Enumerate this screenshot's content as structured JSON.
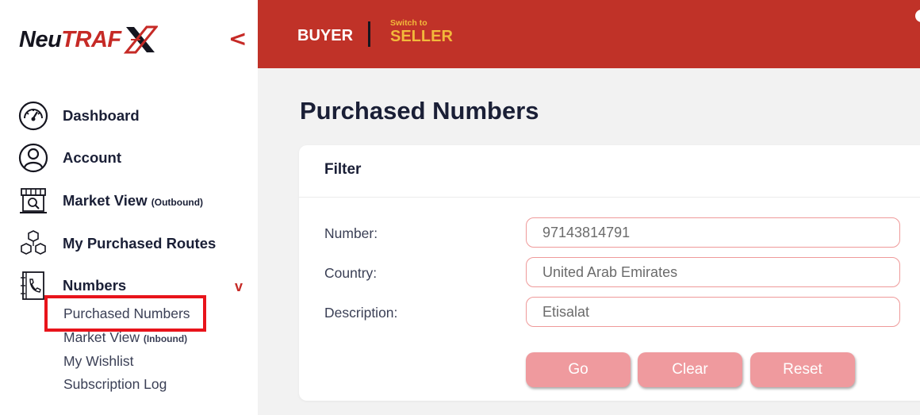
{
  "brand": {
    "part1": "Neu",
    "part2": "TRAF",
    "mark": "X"
  },
  "sidebar": {
    "collapse_glyph": "<",
    "items": [
      {
        "label": "Dashboard",
        "icon": "dashboard-gauge-icon"
      },
      {
        "label": "Account",
        "icon": "user-circle-icon"
      },
      {
        "label": "Market View",
        "suffix": "(Outbound)",
        "icon": "storefront-search-icon"
      },
      {
        "label": "My Purchased Routes",
        "icon": "cubes-network-icon"
      },
      {
        "label": "Numbers",
        "icon": "phone-book-icon",
        "expand_glyph": "v"
      }
    ],
    "sub_items": [
      {
        "label": "Purchased Numbers"
      },
      {
        "label": "Market View",
        "suffix": "(Inbound)"
      },
      {
        "label": "My Wishlist"
      },
      {
        "label": "Subscription Log"
      }
    ]
  },
  "topbar": {
    "role": "BUYER",
    "switch_small": "Switch to",
    "switch_big": "SELLER"
  },
  "main": {
    "title": "Purchased Numbers",
    "filter": {
      "header": "Filter",
      "fields": [
        {
          "label": "Number:",
          "value": "97143814791"
        },
        {
          "label": "Country:",
          "value": "United Arab Emirates"
        },
        {
          "label": "Description:",
          "value": "Etisalat"
        }
      ],
      "buttons": {
        "go": "Go",
        "clear": "Clear",
        "reset": "Reset"
      }
    }
  },
  "colors": {
    "accent": "#c03228",
    "gold": "#f2b93b",
    "button": "#ef9a9e",
    "highlight": "#e8141b"
  }
}
